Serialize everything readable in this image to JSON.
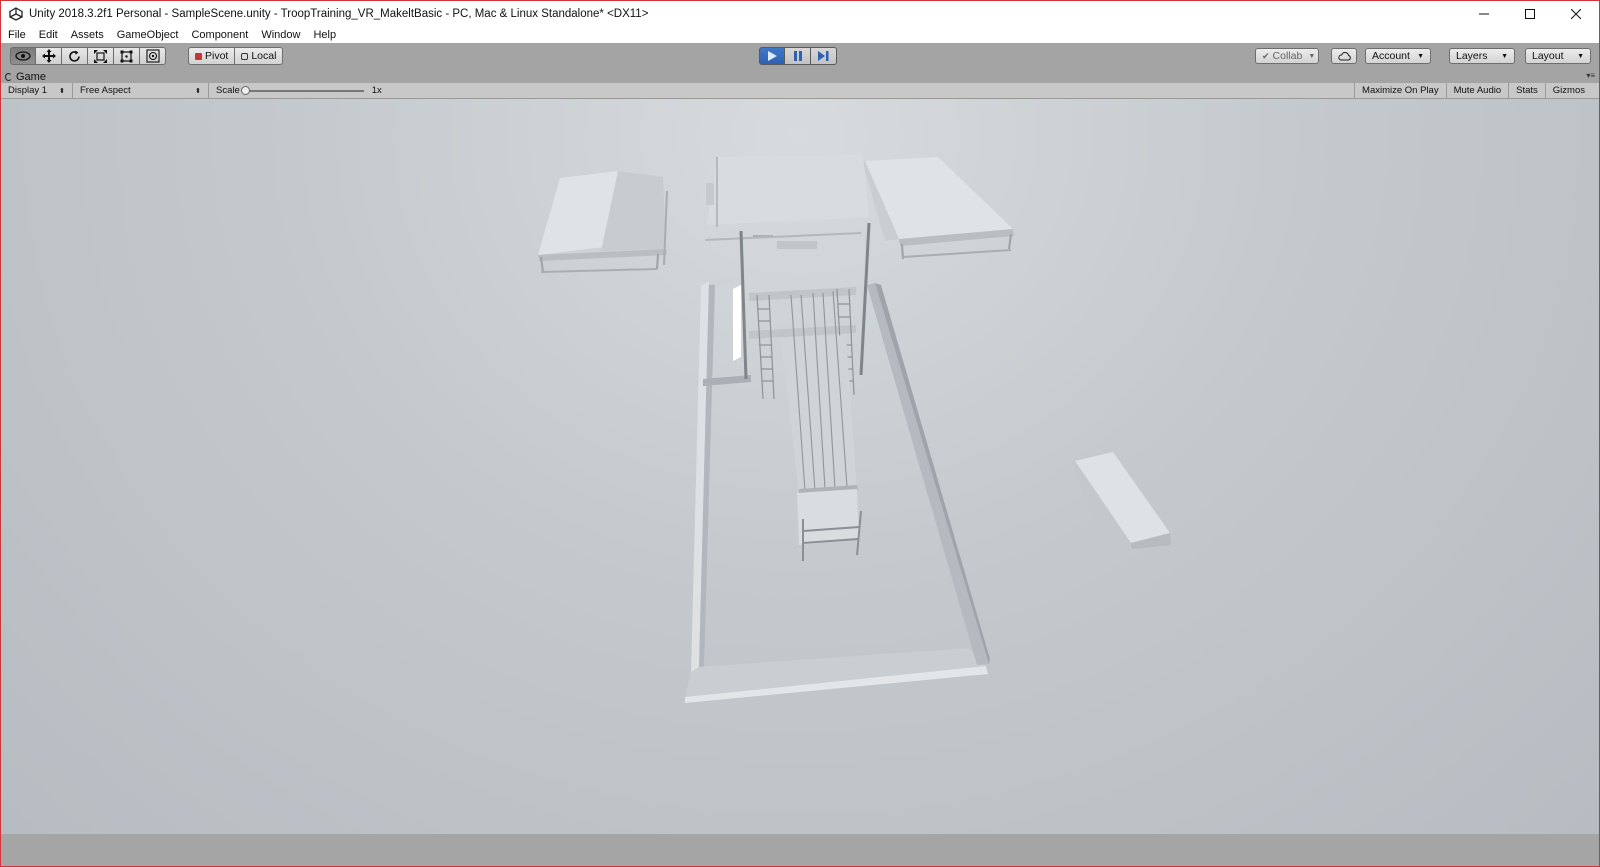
{
  "window": {
    "title": "Unity 2018.3.2f1 Personal - SampleScene.unity - TroopTraining_VR_MakeltBasic - PC, Mac & Linux Standalone* <DX11>",
    "app_icon": "unity-logo-icon",
    "controls": [
      "minimize-icon",
      "maximize-icon",
      "close-icon"
    ]
  },
  "menu": {
    "items": [
      "File",
      "Edit",
      "Assets",
      "GameObject",
      "Component",
      "Window",
      "Help"
    ]
  },
  "toolbar": {
    "tools": [
      "hand-icon",
      "move-icon",
      "rotate-icon",
      "scale-icon",
      "rect-icon",
      "transform-icon"
    ],
    "pivot_label": "Pivot",
    "local_label": "Local",
    "playback": [
      "play-icon",
      "pause-icon",
      "step-icon"
    ],
    "collab_label": "Collab",
    "account_label": "Account",
    "layers_label": "Layers",
    "layout_label": "Layout"
  },
  "game_view": {
    "tab_label": "Game",
    "display_label": "Display 1",
    "aspect_label": "Free Aspect",
    "scale_label": "Scale",
    "scale_value": "1x",
    "maximize_label": "Maximize On Play",
    "mute_label": "Mute Audio",
    "stats_label": "Stats",
    "gizmos_label": "Gizmos"
  },
  "colors": {
    "accent_play": "#2f67b6",
    "toolbar_bg": "#a4a4a4",
    "window_border": "#d0343a",
    "scene_bg": "#c4c9cd"
  }
}
